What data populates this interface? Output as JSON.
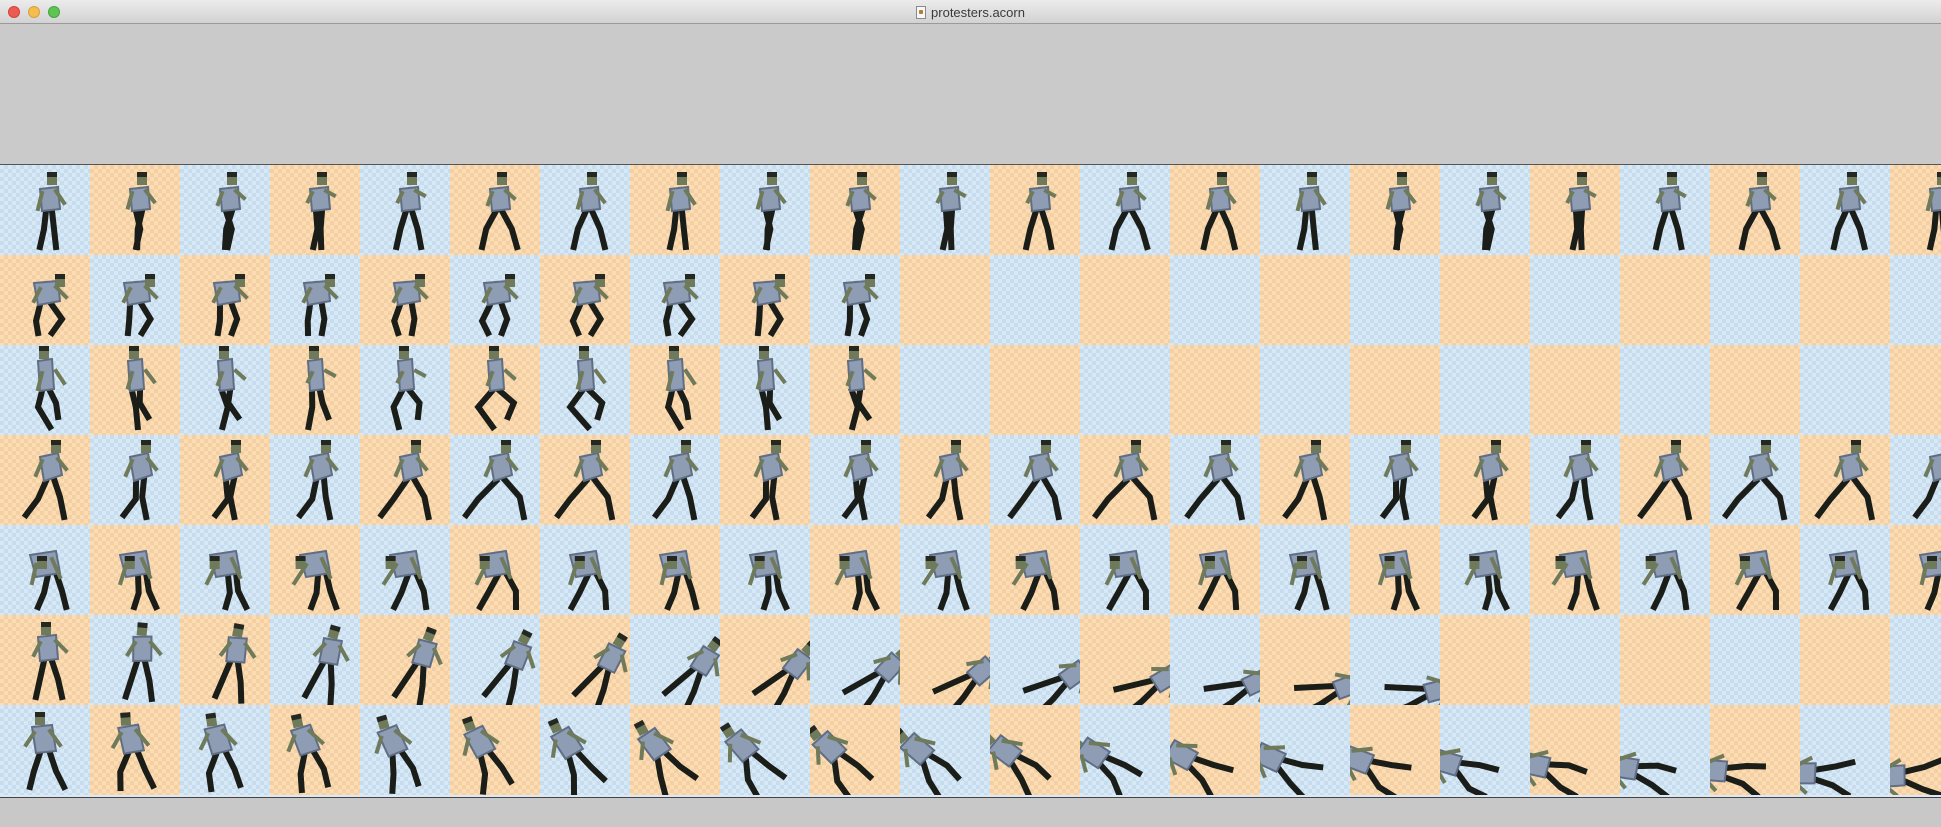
{
  "window": {
    "title": "protesters.acorn"
  },
  "sprite_sheet": {
    "cols": 22,
    "rows": [
      {
        "frames": 22,
        "pose": "walking-upright"
      },
      {
        "frames": 10,
        "pose": "crouching"
      },
      {
        "frames": 10,
        "pose": "climbing"
      },
      {
        "frames": 22,
        "pose": "running"
      },
      {
        "frames": 22,
        "pose": "bending-over"
      },
      {
        "frames": 16,
        "pose": "falling-down"
      },
      {
        "frames": 22,
        "pose": "knocked-down"
      }
    ],
    "colors": {
      "checker_blue": "#d9e8f5",
      "checker_orange": "#fbdcb5",
      "shirt": "#8e9db3",
      "shirt_shade": "#5f6e84",
      "pants": "#1a1d18",
      "skin": "#6f7a5a",
      "hair": "#252820"
    }
  }
}
